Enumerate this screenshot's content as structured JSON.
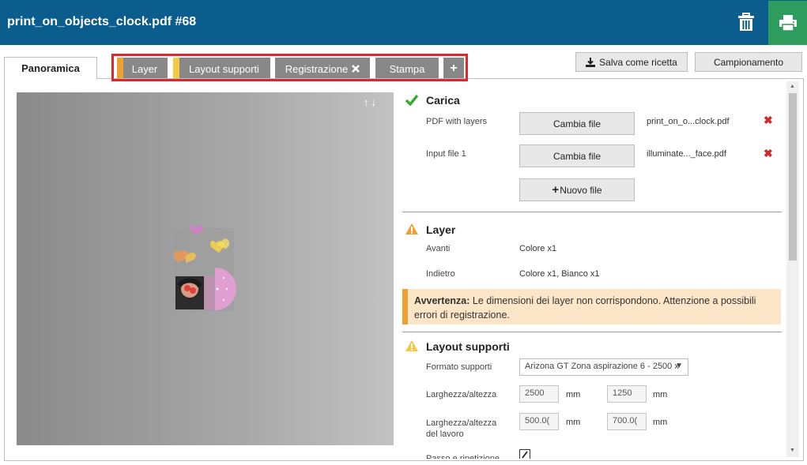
{
  "header": {
    "title": "print_on_objects_clock.pdf #68",
    "trash_icon": "trash-icon",
    "print_icon": "print-icon"
  },
  "tabs": {
    "panoramica": "Panoramica",
    "layer": "Layer",
    "layout": "Layout supporti",
    "registrazione": "Registrazione",
    "stampa": "Stampa",
    "plus": "+"
  },
  "toolbar": {
    "save_recipe": "Salva come ricetta",
    "sampling": "Campionamento"
  },
  "carica": {
    "title": "Carica",
    "rows": [
      {
        "label": "PDF with layers",
        "button": "Cambia file",
        "file": "print_on_o...clock.pdf"
      },
      {
        "label": "Input file 1",
        "button": "Cambia file",
        "file": "illuminate..._face.pdf"
      }
    ],
    "new_file": "Nuovo file"
  },
  "layer": {
    "title": "Layer",
    "front_label": "Avanti",
    "front_value": "Colore x1",
    "back_label": "Indietro",
    "back_value": "Colore x1, Bianco x1",
    "warning_bold": "Avvertenza:",
    "warning_text": " Le dimensioni dei layer non corrispondono. Attenzione a possibili errori di registrazione."
  },
  "layout": {
    "title": "Layout supporti",
    "media_label": "Formato supporti",
    "media_value": "Arizona GT Zona aspirazione 6 - 2500 x",
    "size_label": "Larghezza/altezza",
    "width": "2500",
    "height": "1250",
    "unit": "mm",
    "job_label_1": "Larghezza/altezza",
    "job_label_2": "del lavoro",
    "job_width": "500.0(",
    "job_height": "700.0(",
    "cut_label": "Passo e ripetizione"
  },
  "colors": {
    "header": "#0b5d8e",
    "print": "#2e9c5d",
    "stripe_orange": "#f0a030",
    "stripe_yellow": "#f5c842",
    "ok_green": "#3aaa35",
    "error_red": "#d42727"
  }
}
